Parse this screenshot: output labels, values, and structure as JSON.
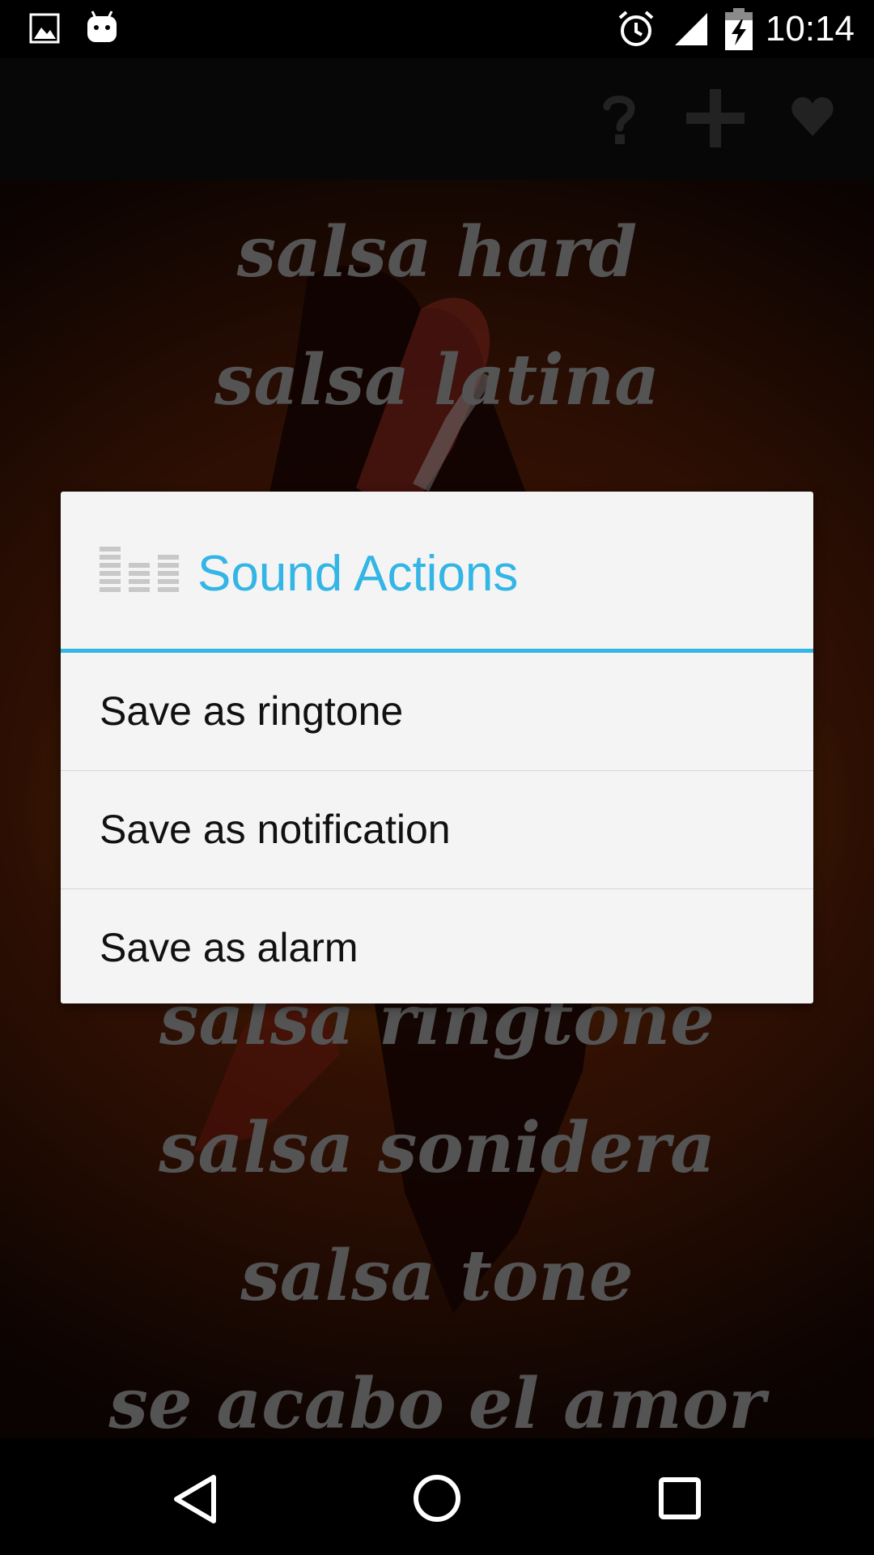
{
  "status_bar": {
    "time": "10:14",
    "icons": [
      "image-icon",
      "android-icon",
      "alarm-clock-icon",
      "signal-icon",
      "battery-charging-icon"
    ]
  },
  "app_bar": {
    "actions": [
      "help-icon",
      "add-icon",
      "favorite-heart-icon"
    ]
  },
  "sound_list": {
    "items": [
      "salsa hard",
      "salsa latina",
      "salsa ringtone",
      "salsa sonidera",
      "salsa tone",
      "se acabo el amor"
    ]
  },
  "dialog": {
    "title": "Sound Actions",
    "icon": "equalizer-icon",
    "accent_color": "#33b5e5",
    "options": [
      "Save as ringtone",
      "Save as notification",
      "Save as alarm"
    ]
  },
  "nav_bar": {
    "buttons": [
      "back-icon",
      "home-icon",
      "recents-icon"
    ]
  }
}
